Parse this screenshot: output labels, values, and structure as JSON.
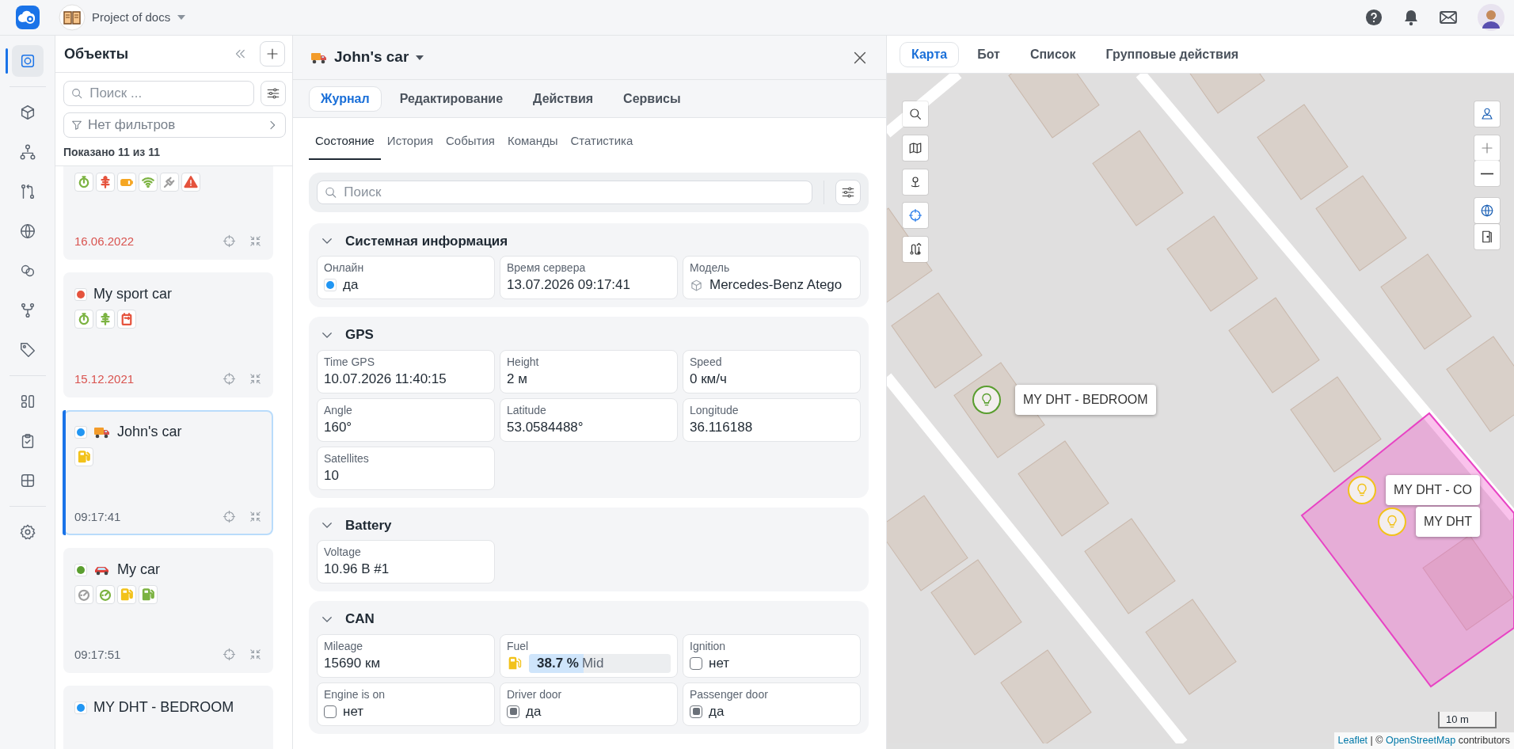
{
  "topbar": {
    "project": "Project of docs"
  },
  "rail": [
    [
      {
        "kind": "target",
        "selected": true
      }
    ],
    [
      {
        "kind": "cube",
        "selected": false
      },
      {
        "kind": "hierarchy",
        "selected": false
      },
      {
        "kind": "compare",
        "selected": false
      },
      {
        "kind": "globe",
        "selected": false
      },
      {
        "kind": "circles",
        "selected": false
      },
      {
        "kind": "fork",
        "selected": false
      },
      {
        "kind": "tag",
        "selected": false
      }
    ],
    [
      {
        "kind": "widgets",
        "selected": false
      },
      {
        "kind": "clipboard",
        "selected": false
      },
      {
        "kind": "grid",
        "selected": false
      }
    ],
    [
      {
        "kind": "gear",
        "selected": false
      }
    ]
  ],
  "objects_panel": {
    "title": "Объекты",
    "search_placeholder": "Поиск ...",
    "filter": "Нет фильтров",
    "shown": "Показано 11 из 11",
    "objects": [
      {
        "selected": false,
        "sensors": [
          {
            "kind": "stopwatch",
            "color": "#7cb342"
          },
          {
            "kind": "antenna",
            "color": "#e5533d"
          },
          {
            "kind": "battery",
            "color": "#f5a623"
          },
          {
            "kind": "wifi",
            "color": "#7cb342"
          },
          {
            "kind": "plug",
            "color": "#9e9e9e"
          },
          {
            "kind": "warning",
            "color": "#e5533d"
          }
        ],
        "time": "16.06.2022",
        "expired": true
      },
      {
        "name": "My sport car",
        "color": "#e5533d",
        "selected": false,
        "sensors": [
          {
            "kind": "stopwatch",
            "color": "#7cb342"
          },
          {
            "kind": "antenna",
            "color": "#7cb342"
          },
          {
            "kind": "battery-v",
            "color": "#e5533d"
          }
        ],
        "time": "15.12.2021",
        "expired": true
      },
      {
        "name": "John's car",
        "color": "#2196f3",
        "kind": "truck",
        "selected": true,
        "sensors": [
          {
            "kind": "fuel",
            "color": "#f2c21b"
          }
        ],
        "time": "09:17:41",
        "expired": false
      },
      {
        "name": "My car",
        "color": "#5a9e2f",
        "kind": "car",
        "selected": false,
        "sensors": [
          {
            "kind": "gauge",
            "color": "#9e9e9e"
          },
          {
            "kind": "gauge",
            "color": "#7cb342"
          },
          {
            "kind": "fuel",
            "color": "#f2c21b"
          },
          {
            "kind": "fuel",
            "color": "#7cb342"
          }
        ],
        "time": "09:17:51",
        "expired": false
      },
      {
        "name": "MY DHT - BEDROOM",
        "color": "#2196f3",
        "selected": false
      }
    ]
  },
  "detail": {
    "title": "John's car",
    "kind": "truck",
    "tabs": [
      {
        "label": "Журнал",
        "selected": true
      },
      {
        "label": "Редактирование",
        "selected": false
      },
      {
        "label": "Действия",
        "selected": false
      },
      {
        "label": "Сервисы",
        "selected": false
      }
    ],
    "subtabs": [
      {
        "label": "Состояние",
        "selected": true
      },
      {
        "label": "История",
        "selected": false
      },
      {
        "label": "События",
        "selected": false
      },
      {
        "label": "Команды",
        "selected": false
      },
      {
        "label": "Статистика",
        "selected": false
      }
    ],
    "search_placeholder": "Поиск",
    "sections": [
      {
        "title": "Системная информация",
        "expanded": true,
        "fields": [
          {
            "kind": "status",
            "label": "Онлайн",
            "value": "да",
            "color": "#2196f3"
          },
          {
            "kind": "text",
            "label": "Время сервера",
            "value": "13.07.2026 09:17:41"
          },
          {
            "kind": "model",
            "label": "Модель",
            "value": "Mercedes-Benz Atego"
          }
        ]
      },
      {
        "title": "GPS",
        "expanded": true,
        "fields": [
          {
            "kind": "text",
            "label": "Time GPS",
            "value": "10.07.2026 11:40:15"
          },
          {
            "kind": "text",
            "label": "Height",
            "value": "2 м"
          },
          {
            "kind": "text",
            "label": "Speed",
            "value": "0 км/ч"
          },
          {
            "kind": "text",
            "label": "Angle",
            "value": "160°"
          },
          {
            "kind": "text",
            "label": "Latitude",
            "value": "53.0584488°"
          },
          {
            "kind": "text",
            "label": "Longitude",
            "value": "36.116188"
          },
          {
            "kind": "text",
            "label": "Satellites",
            "value": "10"
          }
        ]
      },
      {
        "title": "Battery",
        "expanded": true,
        "fields": [
          {
            "kind": "text",
            "label": "Voltage",
            "value": "10.96 В #1"
          }
        ]
      },
      {
        "title": "CAN",
        "expanded": true,
        "fields": [
          {
            "kind": "text",
            "label": "Mileage",
            "value": "15690 км"
          },
          {
            "kind": "fuel",
            "label": "Fuel",
            "level": 0.387,
            "reading": "38.7 %",
            "note": "Mid"
          },
          {
            "kind": "flag",
            "label": "Ignition",
            "value": "нет",
            "checked": false
          },
          {
            "kind": "flag",
            "label": "Engine is on",
            "value": "нет",
            "checked": false
          },
          {
            "kind": "flag",
            "label": "Driver door",
            "value": "да",
            "checked": true
          },
          {
            "kind": "flag",
            "label": "Passenger door",
            "value": "да",
            "checked": true
          }
        ]
      }
    ]
  },
  "map_panel": {
    "tabs": [
      {
        "label": "Карта",
        "selected": true
      },
      {
        "label": "Бот",
        "selected": false
      },
      {
        "label": "Список",
        "selected": false
      },
      {
        "label": "Групповые действия",
        "selected": false
      }
    ],
    "markers": [
      {
        "label": "MY DHT - BEDROOM",
        "color": "#5a9e2f"
      },
      {
        "label": "MY DHT - CO",
        "color": "#f2c21b"
      },
      {
        "label": "MY DHT",
        "color": "#f2c21b"
      }
    ],
    "scale": "10 m",
    "attribution": {
      "link_1": "Leaflet",
      "middle": "| ©",
      "link_2": "OpenStreetMap",
      "end": "contributors"
    }
  }
}
